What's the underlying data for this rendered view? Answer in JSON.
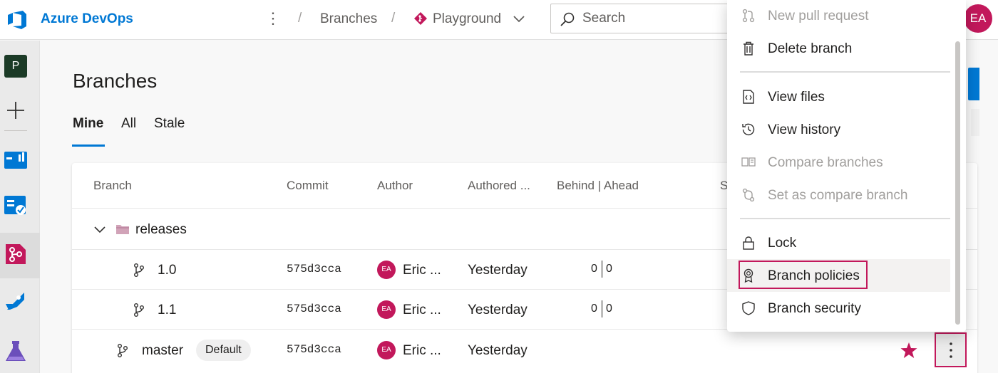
{
  "header": {
    "brand": "Azure DevOps",
    "breadcrumb_branches": "Branches",
    "breadcrumb_repo": "Playground",
    "search_placeholder": "Search",
    "user_initials": "EA"
  },
  "leftnav": {
    "project_initial": "P",
    "items": [
      "add-icon",
      "overview-icon",
      "boards-icon",
      "repos-icon",
      "pipelines-icon",
      "test-plans-icon"
    ]
  },
  "page": {
    "title": "Branches",
    "tabs": [
      {
        "label": "Mine",
        "selected": true
      },
      {
        "label": "All",
        "selected": false
      },
      {
        "label": "Stale",
        "selected": false
      }
    ]
  },
  "table": {
    "columns": [
      "Branch",
      "Commit",
      "Author",
      "Authored ...",
      "Behind | Ahead",
      "S"
    ],
    "folder": {
      "name": "releases"
    },
    "rows": [
      {
        "name": "1.0",
        "commit": "575d3cca",
        "author_initials": "EA",
        "author": "Eric ...",
        "authored": "Yesterday",
        "behind": "0",
        "ahead": "0"
      },
      {
        "name": "1.1",
        "commit": "575d3cca",
        "author_initials": "EA",
        "author": "Eric ...",
        "authored": "Yesterday",
        "behind": "0",
        "ahead": "0"
      },
      {
        "name": "master",
        "badge": "Default",
        "commit": "575d3cca",
        "author_initials": "EA",
        "author": "Eric ...",
        "authored": "Yesterday"
      }
    ]
  },
  "menu": {
    "items": [
      {
        "label": "New pull request",
        "icon": "pull-request-icon",
        "disabled": true
      },
      {
        "label": "Delete branch",
        "icon": "trash-icon",
        "disabled": false
      },
      {
        "label": "View files",
        "icon": "file-code-icon",
        "disabled": false
      },
      {
        "label": "View history",
        "icon": "history-icon",
        "disabled": false
      },
      {
        "label": "Compare branches",
        "icon": "compare-icon",
        "disabled": true
      },
      {
        "label": "Set as compare branch",
        "icon": "compare-branch-icon",
        "disabled": true
      },
      {
        "label": "Lock",
        "icon": "lock-icon",
        "disabled": false
      },
      {
        "label": "Branch policies",
        "icon": "badge-icon",
        "disabled": false,
        "highlighted": true
      },
      {
        "label": "Branch security",
        "icon": "shield-icon",
        "disabled": false
      }
    ]
  },
  "colors": {
    "accent": "#0078d4",
    "avatar": "#c2185b",
    "highlight": "#c2185b"
  }
}
